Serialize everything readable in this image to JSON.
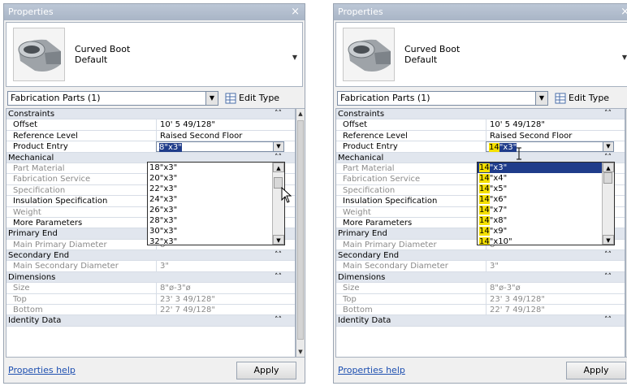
{
  "panels": [
    {
      "title": "Properties",
      "type_name": "Curved Boot",
      "type_sub": "Default",
      "selector": "Fabrication Parts (1)",
      "edit_type": "Edit Type",
      "rows": [
        {
          "kind": "group",
          "label": "Constraints"
        },
        {
          "kind": "prop",
          "label": "Offset",
          "value": "10'  5 49/128\""
        },
        {
          "kind": "prop",
          "label": "Reference Level",
          "value": "Raised Second Floor"
        },
        {
          "kind": "combo",
          "label": "Product Entry",
          "value": "8\"x3\""
        },
        {
          "kind": "group",
          "label": "Mechanical"
        },
        {
          "kind": "prop",
          "dim": true,
          "label": "Part Material",
          "value": ""
        },
        {
          "kind": "prop",
          "dim": true,
          "label": "Fabrication Service",
          "value": ""
        },
        {
          "kind": "prop",
          "dim": true,
          "label": "Specification",
          "value": ""
        },
        {
          "kind": "prop",
          "label": "Insulation Specification",
          "value": ""
        },
        {
          "kind": "prop",
          "dim": true,
          "label": "Weight",
          "value": ""
        },
        {
          "kind": "prop",
          "label": "More Parameters",
          "value": ""
        },
        {
          "kind": "group",
          "label": "Primary End"
        },
        {
          "kind": "prop",
          "dim": true,
          "label": "Main Primary Diameter",
          "value": "8\""
        },
        {
          "kind": "group",
          "label": "Secondary End"
        },
        {
          "kind": "prop",
          "dim": true,
          "label": "Main Secondary Diameter",
          "value": "3\""
        },
        {
          "kind": "group",
          "label": "Dimensions"
        },
        {
          "kind": "prop",
          "dim": true,
          "label": "Size",
          "value": "8\"ø-3\"ø"
        },
        {
          "kind": "prop",
          "dim": true,
          "label": "Top",
          "value": "23'  3 49/128\""
        },
        {
          "kind": "prop",
          "dim": true,
          "label": "Bottom",
          "value": "22'  7 49/128\""
        },
        {
          "kind": "group",
          "label": "Identity Data"
        }
      ],
      "dropdown": [
        "18\"x3\"",
        "20\"x3\"",
        "22\"x3\"",
        "24\"x3\"",
        "26\"x3\"",
        "28\"x3\"",
        "30\"x3\"",
        "32\"x3\""
      ],
      "help": "Properties help",
      "apply": "Apply"
    },
    {
      "title": "Properties",
      "type_name": "Curved Boot",
      "type_sub": "Default",
      "selector": "Fabrication Parts (1)",
      "edit_type": "Edit Type",
      "rows": [
        {
          "kind": "group",
          "label": "Constraints"
        },
        {
          "kind": "prop",
          "label": "Offset",
          "value": "10'  5 49/128\""
        },
        {
          "kind": "prop",
          "label": "Reference Level",
          "value": "Raised Second Floor"
        },
        {
          "kind": "combo",
          "label": "Product Entry",
          "value_prefix": "14",
          "value_hl": "\"x3\""
        },
        {
          "kind": "group",
          "label": "Mechanical"
        },
        {
          "kind": "prop",
          "dim": true,
          "label": "Part Material",
          "value": ""
        },
        {
          "kind": "prop",
          "dim": true,
          "label": "Fabrication Service",
          "value": ""
        },
        {
          "kind": "prop",
          "dim": true,
          "label": "Specification",
          "value": ""
        },
        {
          "kind": "prop",
          "label": "Insulation Specification",
          "value": ""
        },
        {
          "kind": "prop",
          "dim": true,
          "label": "Weight",
          "value": ""
        },
        {
          "kind": "prop",
          "label": "More Parameters",
          "value": ""
        },
        {
          "kind": "group",
          "label": "Primary End"
        },
        {
          "kind": "prop",
          "dim": true,
          "label": "Main Primary Diameter",
          "value": "8\""
        },
        {
          "kind": "group",
          "label": "Secondary End"
        },
        {
          "kind": "prop",
          "dim": true,
          "label": "Main Secondary Diameter",
          "value": "3\""
        },
        {
          "kind": "group",
          "label": "Dimensions"
        },
        {
          "kind": "prop",
          "dim": true,
          "label": "Size",
          "value": "8\"ø-3\"ø"
        },
        {
          "kind": "prop",
          "dim": true,
          "label": "Top",
          "value": "23'  3 49/128\""
        },
        {
          "kind": "prop",
          "dim": true,
          "label": "Bottom",
          "value": "22'  7 49/128\""
        },
        {
          "kind": "group",
          "label": "Identity Data"
        }
      ],
      "dropdown_prefix": "14",
      "dropdown_suffixes": [
        "\"x3\"",
        "\"x4\"",
        "\"x5\"",
        "\"x6\"",
        "\"x7\"",
        "\"x8\"",
        "\"x9\"",
        "\"x10\""
      ],
      "help": "Properties help",
      "apply": "Apply"
    }
  ],
  "icons": {
    "close": "close-icon",
    "edit_type": "edit-type-icon",
    "collapse": "collapse-chevron-icon",
    "dropdown_arrow": "dropdown-arrow-icon",
    "cursor_left": "mouse-pointer-icon",
    "cursor_right": "text-cursor-icon"
  },
  "colors": {
    "title_bar": "#a9b5c6",
    "group_row": "#e1e6ee",
    "selection": "#1f3c8a",
    "match_highlight": "#f5e000",
    "help_link": "#1d4fb0"
  }
}
